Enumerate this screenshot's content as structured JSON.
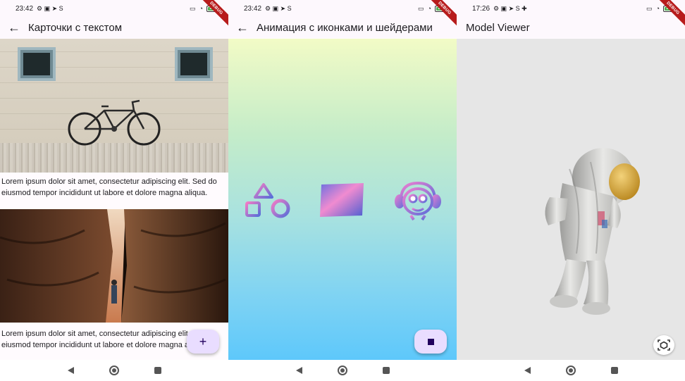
{
  "screens": [
    {
      "status": {
        "time": "23:42",
        "battery": "100"
      },
      "debug_banner": "DEBUG",
      "title": "Карточки с текстом",
      "cards": [
        {
          "caption": "Lorem ipsum dolor sit amet, consectetur adipiscing elit. Sed do eiusmod tempor incididunt ut labore et dolore magna aliqua."
        },
        {
          "caption": "Lorem ipsum dolor sit amet, consectetur adipiscing elit. Sed do eiusmod tempor incididunt ut labore et dolore magna aliqua."
        }
      ],
      "fab_label": "+"
    },
    {
      "status": {
        "time": "23:42",
        "battery": "100"
      },
      "debug_banner": "DEBUG",
      "title": "Анимация с иконками и шейдерами",
      "icons": [
        "shapes-icon",
        "gradient-square-icon",
        "monkey-headphones-icon"
      ],
      "fab_icon": "stop-icon"
    },
    {
      "status": {
        "time": "17:26",
        "battery": "100"
      },
      "debug_banner": "DEBUG",
      "title": "Model Viewer",
      "model": "astronaut",
      "ar_icon": "view-in-ar-icon"
    }
  ],
  "colors": {
    "fab": "#e9ddff",
    "fab_icon": "#21005d",
    "gradient_top": "#f2fbc6",
    "gradient_bottom": "#5ec8fb",
    "debug": "#b71c1c"
  }
}
